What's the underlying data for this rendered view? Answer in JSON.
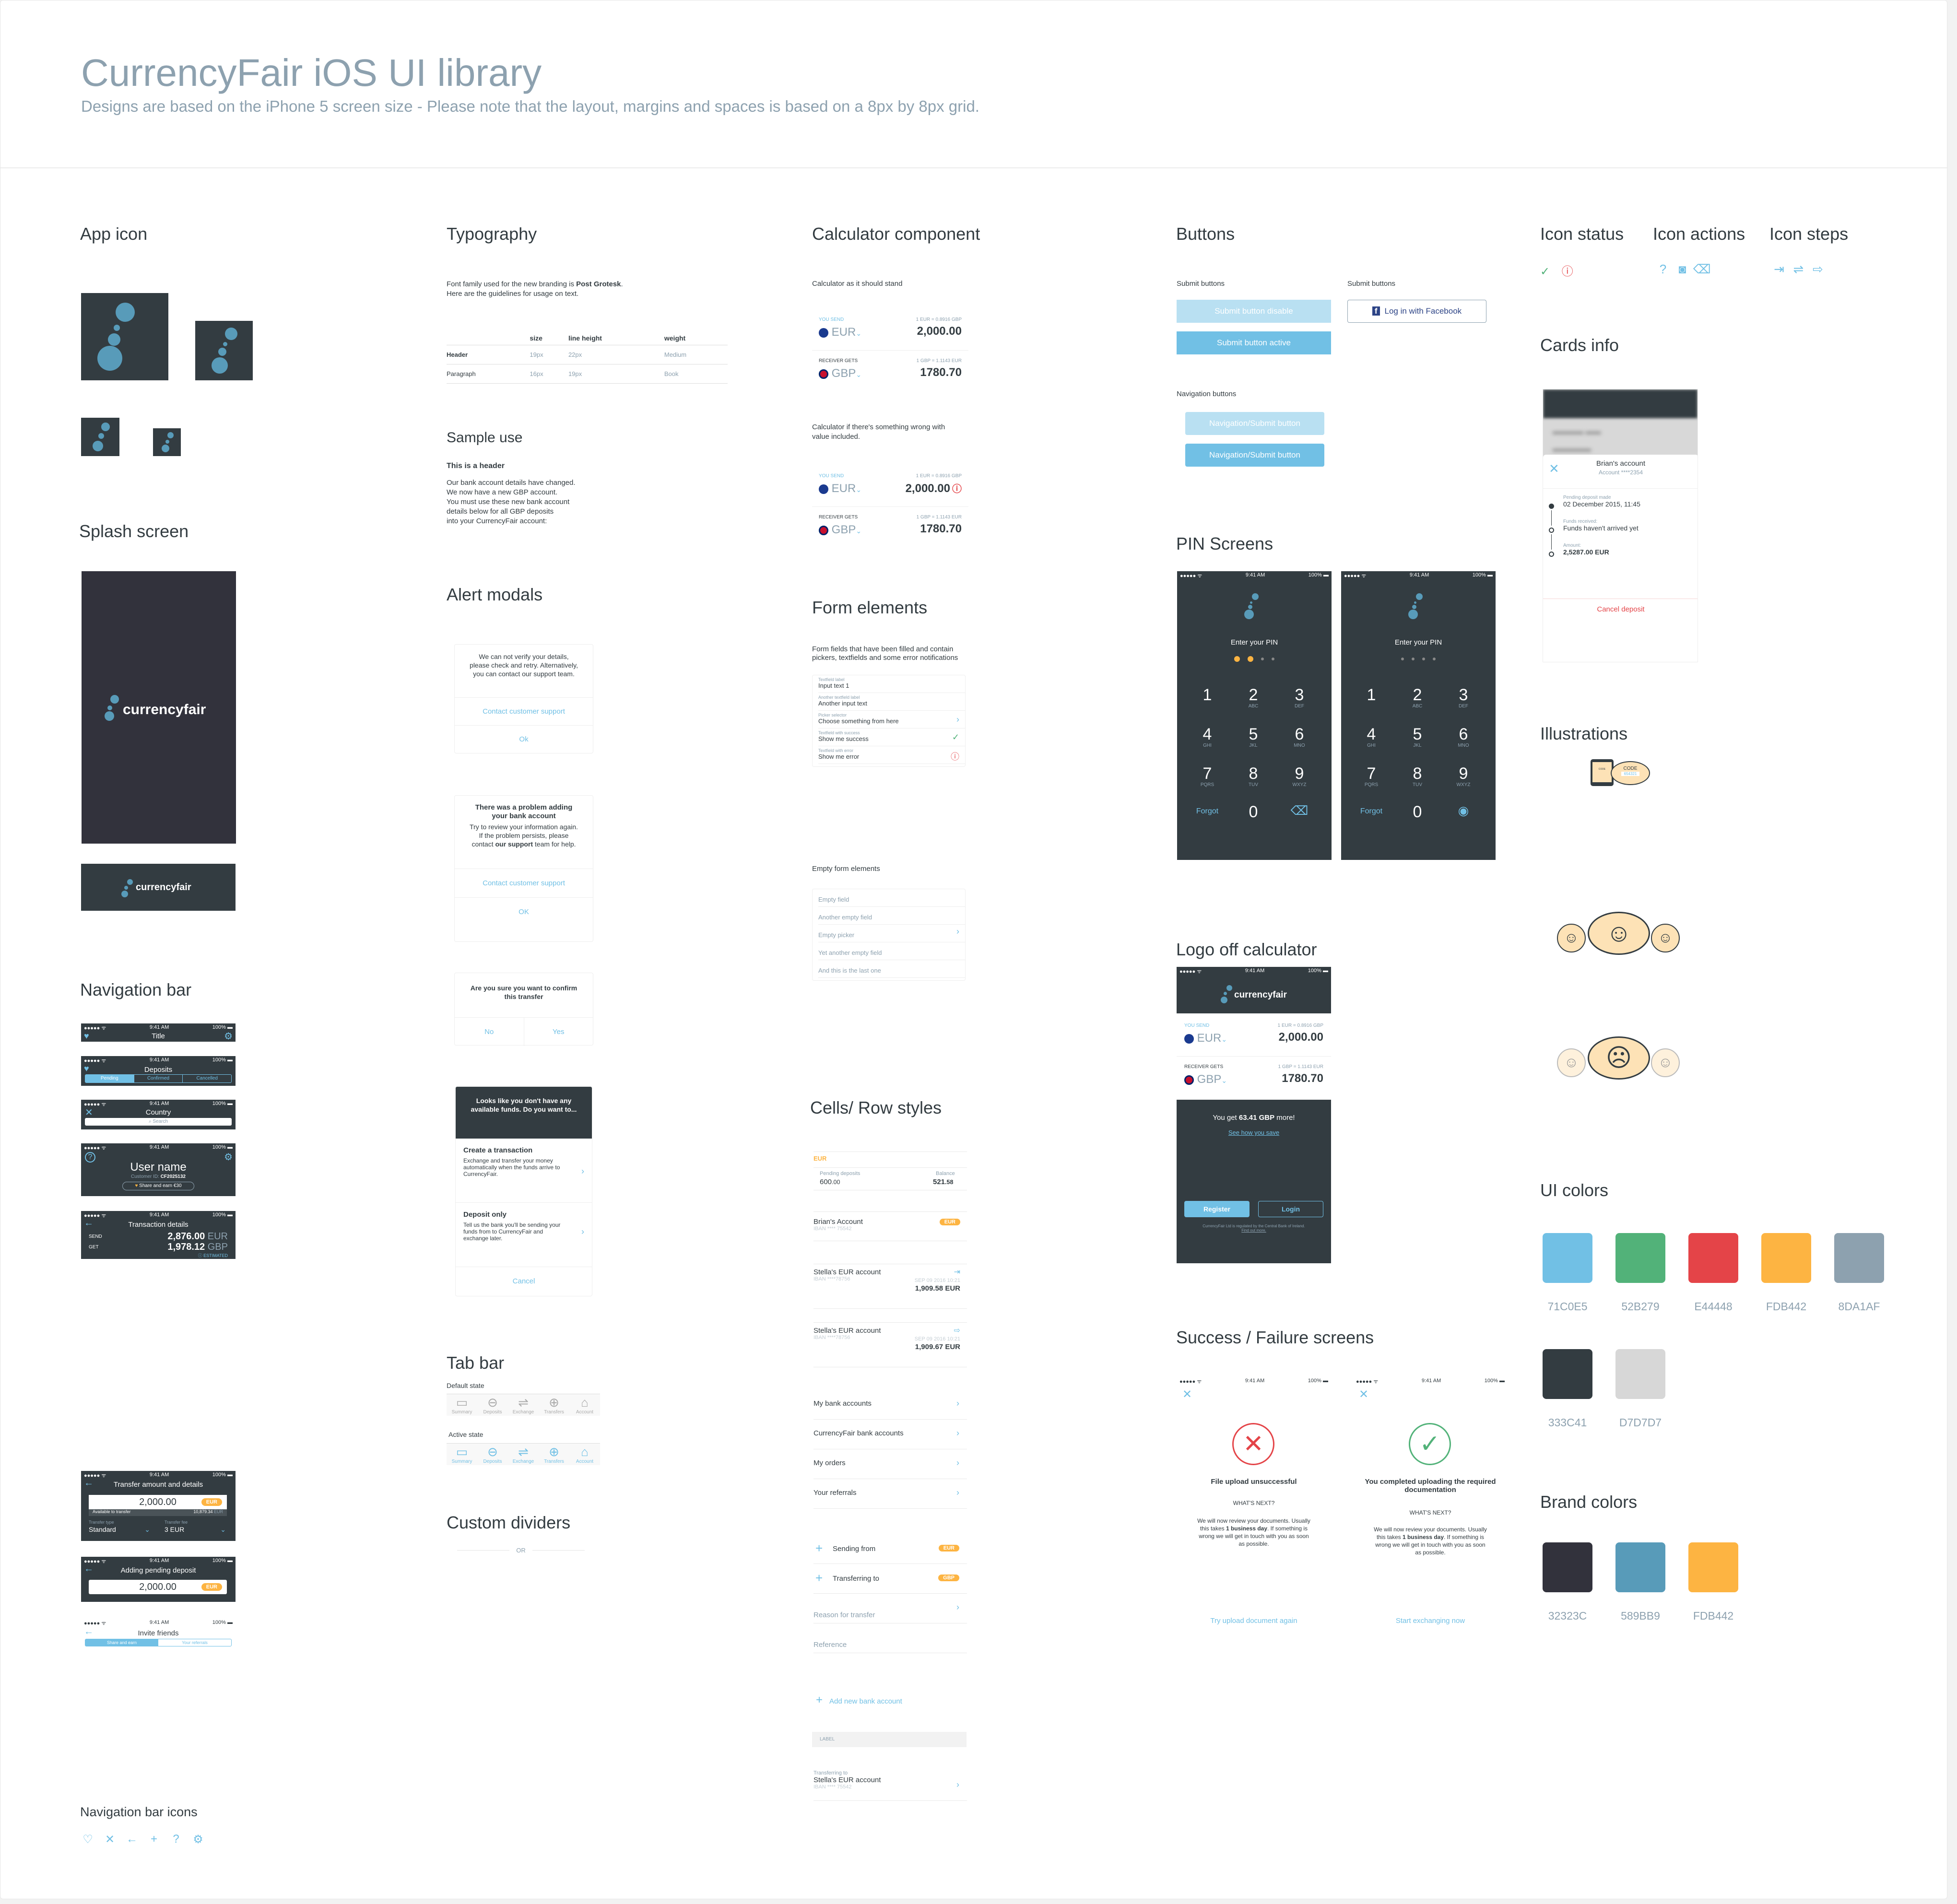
{
  "header": {
    "title": "CurrencyFair iOS UI library",
    "subtitle": "Designs are based on the iPhone 5 screen size - Please note that the layout, margins and spaces is based on a 8px by 8px grid."
  },
  "status_bar": {
    "signal": "●●●●● ᯤ",
    "time": "9:41 AM",
    "battery": "100% ▬"
  },
  "sections": {
    "app_icon": "App icon",
    "splash": "Splash screen",
    "navigation_bar": "Navigation bar",
    "nav_icons": "Navigation bar icons",
    "typography": "Typography",
    "sample_use": "Sample use",
    "alert_modals": "Alert modals",
    "tab_bar": "Tab bar",
    "custom_dividers": "Custom dividers",
    "calculator": "Calculator component",
    "form_elements": "Form elements",
    "cells": "Cells/ Row styles",
    "buttons": "Buttons",
    "pin": "PIN Screens",
    "logo_calc": "Logo off calculator",
    "success_failure": "Success / Failure screens",
    "icon_status": "Icon status",
    "icon_actions": "Icon actions",
    "icon_steps": "Icon steps",
    "cards_info": "Cards info",
    "illustrations": "Illustrations",
    "ui_colors": "UI colors",
    "brand_colors": "Brand colors"
  },
  "brand": {
    "wordmark": "currencyfair"
  },
  "nav_bars": {
    "title": "Title",
    "deposits": {
      "title": "Deposits",
      "segments": [
        "Pending",
        "Confirmed",
        "Cancelled"
      ]
    },
    "country": {
      "title": "Country",
      "search_placeholder": "Search"
    },
    "user": {
      "name": "User name",
      "customer_id_label": "Customer ID:",
      "customer_id": "CF2025132",
      "share": "Share and earn €30"
    },
    "transaction": {
      "title": "Transaction details",
      "send_label": "SEND",
      "send_value": "2,876.00",
      "send_cur": "EUR",
      "get_label": "GET",
      "get_value": "1,978.12",
      "get_cur": "GBP",
      "estimated": "ESTIMATED"
    },
    "transfer": {
      "title": "Transfer amount and details",
      "amount": "2,000.00",
      "currency": "EUR",
      "available_label": "Available to transfer",
      "available_value": "10,879.34",
      "available_cur": "EUR",
      "type_label": "Transfer type",
      "type_value": "Standard",
      "fee_label": "Transfer fee",
      "fee_value": "3 EUR"
    },
    "pending": {
      "title": "Adding pending deposit",
      "amount": "2,000.00",
      "currency": "EUR"
    },
    "invite": {
      "title": "Invite friends",
      "segments": [
        "Share and earn",
        "Your referrals"
      ]
    }
  },
  "nav_icons": [
    {
      "name": "heart-icon",
      "glyph": "♡"
    },
    {
      "name": "close-icon",
      "glyph": "✕"
    },
    {
      "name": "back-arrow-icon",
      "glyph": "←"
    },
    {
      "name": "plus-icon",
      "glyph": "+"
    },
    {
      "name": "help-icon",
      "glyph": "?"
    },
    {
      "name": "gear-icon",
      "glyph": "⚙"
    }
  ],
  "typography": {
    "intro_1": "Font family used for the new branding is ",
    "intro_font": "Post Grotesk",
    "intro_2": "Here are the guidelines for usage on text.",
    "columns": [
      "",
      "size",
      "line height",
      "weight"
    ],
    "rows": [
      [
        "Header",
        "19px",
        "22px",
        "Medium"
      ],
      [
        "Paragraph",
        "16px",
        "19px",
        "Book"
      ]
    ],
    "sample_header": "This is a header",
    "sample_lines": [
      "Our bank account details have changed.",
      "We now have a new GBP account.",
      "You must use these new bank account",
      "details below for all GBP deposits",
      "into your CurrencyFair account:"
    ]
  },
  "alerts": [
    {
      "message": "We can not verify your details, please check and retry. Alternatively, you can contact our support team.",
      "buttons": [
        "Contact customer support",
        "Ok"
      ]
    },
    {
      "title": "There was a problem adding your bank account",
      "message_1": "Try to review your information again. If the problem persists, please contact ",
      "message_bold": "our support",
      "message_2": " team for help.",
      "buttons": [
        "Contact customer support",
        "OK"
      ]
    },
    {
      "title": "Are you sure you want to confirm this transfer",
      "buttons": [
        "No",
        "Yes"
      ]
    },
    {
      "title": "Looks like you don't have any available funds. Do you want to...",
      "options": [
        {
          "title": "Create a transaction",
          "text": "Exchange and transfer your money automatically when the funds arrive to CurrencyFair."
        },
        {
          "title": "Deposit only",
          "text": "Tell us the bank you'll be sending your funds from to CurrencyFair and exchange later."
        }
      ],
      "cancel": "Cancel"
    }
  ],
  "tab_bar": {
    "default_label": "Default state",
    "active_label": "Active state",
    "tabs": [
      {
        "label": "Summary",
        "glyph": "▭"
      },
      {
        "label": "Deposits",
        "glyph": "⊖"
      },
      {
        "label": "Exchange",
        "glyph": "⇌"
      },
      {
        "label": "Transfers",
        "glyph": "⊕"
      },
      {
        "label": "Account",
        "glyph": "⌂"
      }
    ]
  },
  "divider": {
    "text": "OR"
  },
  "calculator": {
    "normal_caption": "Calculator as it should stand",
    "error_caption": "Calculator if there's something wrong with value included.",
    "send_label": "YOU SEND",
    "send_rate": "1 EUR = 0.8916 GBP",
    "send_cur": "EUR",
    "send_value": "2,000.00",
    "recv_label": "RECEIVER GETS",
    "recv_rate": "1 GBP = 1.1143 EUR",
    "recv_cur": "GBP",
    "recv_value": "1780.70"
  },
  "forms": {
    "filled_caption": "Form fields that have been filled and contain pickers, textfields and some error notifications",
    "filled": [
      {
        "label": "Textfield label",
        "value": "Input text 1",
        "state": "none"
      },
      {
        "label": "Another textfield label",
        "value": "Another input text",
        "state": "none"
      },
      {
        "label": "Picker selector",
        "value": "Choose something from here",
        "state": "picker"
      },
      {
        "label": "Textfield with success",
        "value": "Show me success",
        "state": "success"
      },
      {
        "label": "Textfield with error",
        "value": "Show me error",
        "state": "error"
      }
    ],
    "empty_caption": "Empty form elements",
    "empty": [
      {
        "placeholder": "Empty field"
      },
      {
        "placeholder": "Another empty field"
      },
      {
        "placeholder": "Empty picker",
        "picker": true
      },
      {
        "placeholder": "Yet another empty field"
      },
      {
        "placeholder": "And this is the last one"
      }
    ]
  },
  "cells": {
    "balance": {
      "currency": "EUR",
      "pending_label": "Pending deposits",
      "pending_value": "600",
      "pending_dec": ".00",
      "balance_label": "Balance",
      "balance_value": "521",
      "balance_dec": ".58"
    },
    "account": {
      "name": "Brian's Account",
      "iban": "IBAN **** 75542",
      "badge": "EUR"
    },
    "transactions": [
      {
        "name": "Stella's EUR account",
        "iban": "IBAN ****78756",
        "date": "SEP 09 2016 10:21",
        "amount": "1,909.58 EUR"
      },
      {
        "name": "Stella's EUR account",
        "iban": "IBAN ****78756",
        "date": "SEP 09 2016 10:21",
        "amount": "1,909.67 EUR"
      }
    ],
    "links": [
      "My bank accounts",
      "CurrencyFair bank accounts",
      "My orders",
      "Your referrals"
    ],
    "sending_from": "Sending from",
    "sending_badge": "EUR",
    "transferring_to": "Transferring to",
    "transferring_badge": "GBP",
    "reason": "Reason for transfer",
    "reference": "Reference",
    "add_account": "Add new bank account",
    "section_label": "LABEL",
    "recipient": {
      "label": "Transferring to",
      "name": "Stella's EUR account",
      "iban": "IBAN **** 75542"
    }
  },
  "buttons": {
    "submit_caption": "Submit buttons",
    "disabled": "Submit button disable",
    "active": "Submit button active",
    "fb_caption": "Submit buttons",
    "facebook": "Log in with Facebook",
    "nav_caption": "Navigation buttons",
    "nav_disabled": "Navigation/Submit button",
    "nav_active": "Navigation/Submit button"
  },
  "pin": {
    "prompt": "Enter your PIN",
    "filled_dots": 2,
    "total_dots": 4,
    "keys": [
      {
        "n": "1",
        "l": ""
      },
      {
        "n": "2",
        "l": "ABC"
      },
      {
        "n": "3",
        "l": "DEF"
      },
      {
        "n": "4",
        "l": "GHI"
      },
      {
        "n": "5",
        "l": "JKL"
      },
      {
        "n": "6",
        "l": "MNO"
      },
      {
        "n": "7",
        "l": "PQRS"
      },
      {
        "n": "8",
        "l": "TUV"
      },
      {
        "n": "9",
        "l": "WXYZ"
      }
    ],
    "zero": "0",
    "forgot": "Forgot"
  },
  "logo_calc": {
    "savings_1": "You get ",
    "savings_bold": "63.41 GBP",
    "savings_2": " more!",
    "see_how": "See how you save",
    "register": "Register",
    "login": "Login",
    "legal": "CurrencyFair Ltd is regulated by the Central Bank of Ireland.",
    "find_out": "Find out more."
  },
  "result_screens": [
    {
      "title": "File upload unsuccessful",
      "next": "WHAT'S NEXT?",
      "body_1": "We will now review your documents. Usually this takes ",
      "body_bold": "1 business day",
      "body_2": ". If something is wrong we will get in touch with you as soon as possible.",
      "action": "Try upload document again",
      "type": "failure"
    },
    {
      "title": "You completed uploading the required documentation",
      "next": "WHAT'S NEXT?",
      "body_1": "We will now review your documents. Usually this takes ",
      "body_bold": "1 business day",
      "body_2": ". If something is wrong we will get in touch with you as soon as possible.",
      "action": "Start exchanging now",
      "type": "success"
    }
  ],
  "card_info": {
    "title": "Brian's account",
    "account": "Account ****2354",
    "steps": [
      {
        "label": "Pending deposit made",
        "value": "02 December 2015, 11:45"
      },
      {
        "label": "Funds received:",
        "value": "Funds haven't arrived yet"
      },
      {
        "label": "Amount:",
        "value": "2,5287.00 EUR"
      }
    ],
    "cancel": "Cancel deposit"
  },
  "illustration": {
    "code_small": "CODE",
    "code_big": "CODE",
    "code_value": "654321"
  },
  "ui_colors": [
    "71C0E5",
    "52B279",
    "E44448",
    "FDB442",
    "8DA1AF",
    "333C41",
    "D7D7D7"
  ],
  "brand_colors": [
    "32323C",
    "589BB9",
    "FDB442"
  ]
}
